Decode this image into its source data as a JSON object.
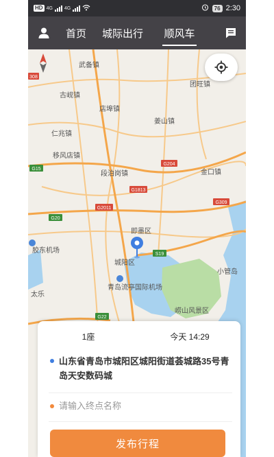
{
  "statusbar": {
    "sim_label": "HD",
    "net1": "4G",
    "net2": "4G",
    "battery": "76",
    "time": "2:30"
  },
  "nav": {
    "tabs": [
      {
        "label": "首页"
      },
      {
        "label": "城际出行"
      },
      {
        "label": "顺风车"
      }
    ],
    "active_tab": "顺风车"
  },
  "map": {
    "places": [
      "武备镇",
      "团旺镇",
      "古岘镇",
      "店埠镇",
      "姜山镇",
      "仁兆镇",
      "移风店镇",
      "段泊岗镇",
      "金口镇",
      "即墨区",
      "胶东机场",
      "城阳区",
      "青岛流亭国际机场",
      "小管岛",
      "崂山风景区",
      "太乐"
    ],
    "roads": [
      "G204",
      "G1813",
      "G2011",
      "G309",
      "G15",
      "G20",
      "S19",
      "G22",
      "308"
    ],
    "colors": {
      "land": "#f2efe9",
      "water": "#a8d2ef",
      "green": "#b9dda5",
      "highway": "#f4a64a",
      "road": "#f7c98a"
    }
  },
  "panel": {
    "seats": "1座",
    "time": "今天 14:29",
    "start_address": "山东省青岛市城阳区城阳街道荟城路35号青岛天安数码城",
    "destination_placeholder": "请输入终点名称",
    "publish_label": "发布行程",
    "accent_color": "#f08a3e"
  }
}
